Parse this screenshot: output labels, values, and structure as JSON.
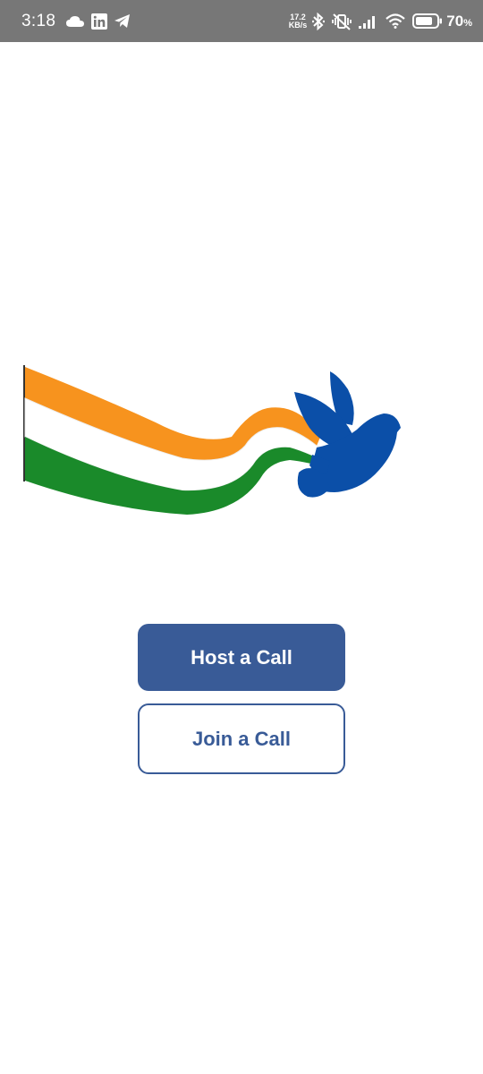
{
  "status_bar": {
    "time": "3:18",
    "net_speed_value": "17.2",
    "net_speed_unit": "KB/s",
    "battery_percent": "70",
    "battery_unit": "%",
    "icons": [
      "cloud-icon",
      "linkedin-icon",
      "telegram-icon",
      "bluetooth-icon",
      "vibrate-off-icon",
      "signal-icon",
      "wifi-icon",
      "battery-icon"
    ]
  },
  "main": {
    "logo": "flag-dove-logo",
    "flag_colors": {
      "saffron": "#f7931e",
      "white": "#ffffff",
      "green": "#1a8a2a"
    },
    "dove_color": "#0b4fa8",
    "host_button_label": "Host a Call",
    "join_button_label": "Join a Call"
  },
  "colors": {
    "status_bar_bg": "#777777",
    "accent": "#395b97",
    "background": "#ffffff"
  }
}
